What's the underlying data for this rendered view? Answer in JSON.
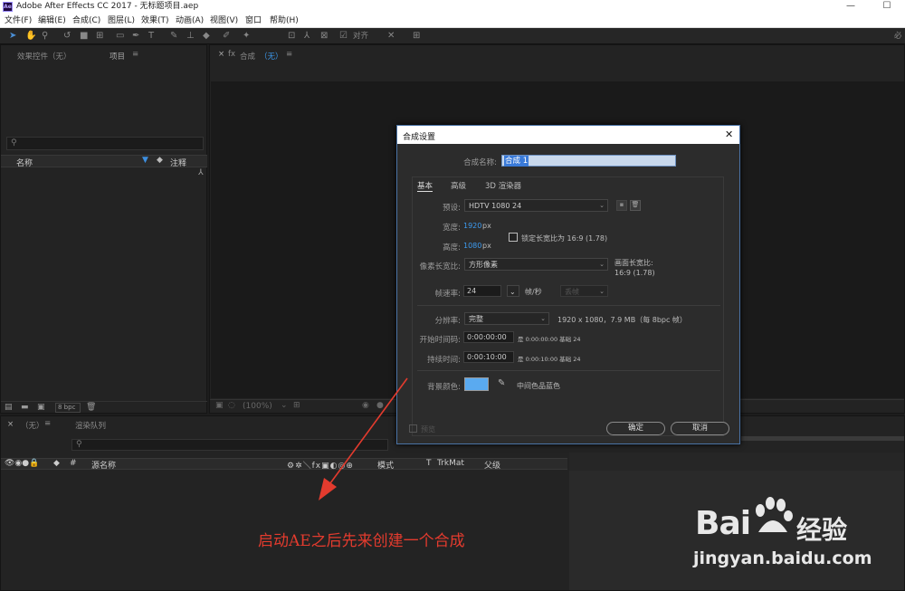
{
  "app": {
    "title": "Adobe After Effects CC 2017 - 无标题项目.aep",
    "logo": "Ae",
    "win_min": "—",
    "win_max": "☐"
  },
  "menu": [
    "文件(F)",
    "编辑(E)",
    "合成(C)",
    "图层(L)",
    "效果(T)",
    "动画(A)",
    "视图(V)",
    "窗口",
    "帮助(H)"
  ],
  "toolbar": {
    "snap_label": "对齐",
    "right_label": "必"
  },
  "project_panel": {
    "tab_effects": "效果控件（无）",
    "tab_project": "项目",
    "col_name": "名称",
    "col_comment": "注释",
    "bpc": "8 bpc"
  },
  "comp_viewer": {
    "tab_prefix": "合成",
    "tab_name": "（无）",
    "zoom": "(100%)"
  },
  "timeline": {
    "tab_none": "（无）",
    "tab_render": "渲染队列",
    "col_source": "源名称",
    "col_mode": "模式",
    "col_t": "T",
    "col_trkmat": "TrkMat",
    "col_parent": "父级"
  },
  "dialog": {
    "title": "合成设置",
    "close": "✕",
    "name_label": "合成名称:",
    "name_value": "合成 1",
    "tabs": [
      "基本",
      "高级",
      "3D 渲染器"
    ],
    "preset_label": "预设:",
    "preset_value": "HDTV 1080 24",
    "width_label": "宽度:",
    "width_value": "1920",
    "width_unit": "px",
    "height_label": "高度:",
    "height_value": "1080",
    "height_unit": "px",
    "lock_label": "锁定长宽比为 16:9 (1.78)",
    "lock_checked": false,
    "par_label": "像素长宽比:",
    "par_value": "方形像素",
    "frame_aspect_label": "画面长宽比:",
    "frame_aspect_value": "16:9 (1.78)",
    "fps_label": "帧速率:",
    "fps_value": "24",
    "fps_unit": "帧/秒",
    "drop_frame_value": "丢帧",
    "res_label": "分辨率:",
    "res_value": "完整",
    "res_info": "1920 x 1080，7.9 MB（每 8bpc 帧）",
    "start_label": "开始时间码:",
    "start_value": "0:00:00:00",
    "start_info": "是 0:00:00:00  基础 24",
    "dur_label": "持续时间:",
    "dur_value": "0:00:10:00",
    "dur_info": "是 0:00:10:00  基础 24",
    "bg_label": "背景颜色:",
    "bg_color": "#5aaaf0",
    "bg_name": "中间色品蓝色",
    "preview_label": "预览",
    "ok": "确定",
    "cancel": "取消"
  },
  "annotation": "启动AE之后先来创建一个合成",
  "watermark": {
    "brand": "Bai",
    "brand_cn": "经验",
    "url": "jingyan.baidu.com"
  }
}
